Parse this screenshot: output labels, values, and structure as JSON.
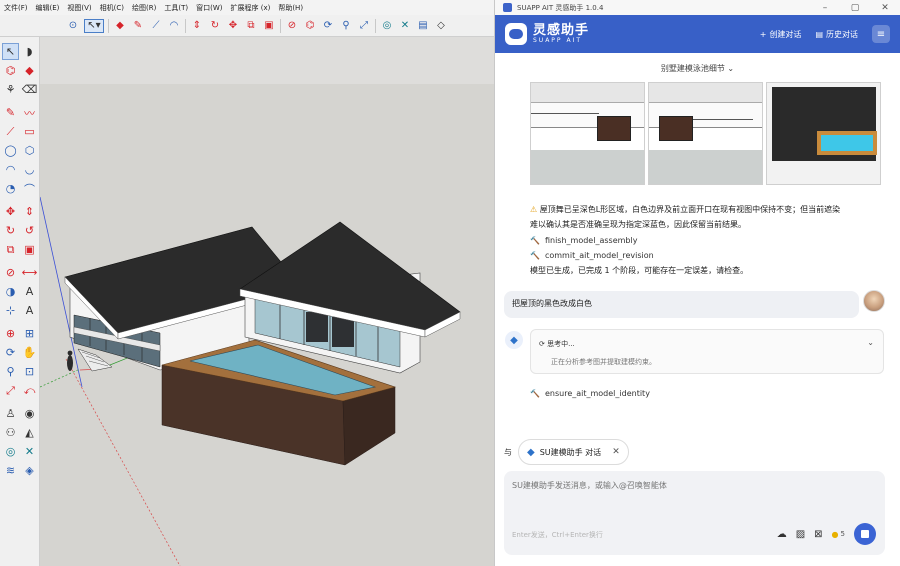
{
  "sketchup": {
    "menus": [
      "文件(F)",
      "编辑(E)",
      "视图(V)",
      "相机(C)",
      "绘图(R)",
      "工具(T)",
      "窗口(W)",
      "扩展程序 (x)",
      "帮助(H)"
    ]
  },
  "assistant": {
    "window_title": "SUAPP AIT 灵感助手 1.0.4",
    "brand_name": "灵感助手",
    "brand_sub": "SUAPP AIT",
    "new_chat": "创建对话",
    "history": "历史对话",
    "session_title": "别墅建模泳池细节",
    "messages": {
      "ai_note_line1": "屋顶舞已呈深色L形区域，白色边界及前立面开口在现有视图中保持不变；但当前遮染",
      "ai_note_line2": "难以确认其是否准确呈现为指定深蓝色，因此保留当前结果。",
      "tool1": "finish_model_assembly",
      "tool2": "commit_ait_model_revision",
      "result": "模型已生成，已完成 1 个阶段，可能存在一定误差，请检查。",
      "user": "把屋顶的黑色改成白色",
      "thinking_title": "思考中...",
      "thinking_desc": "正在分析参考图并提取建模约束。",
      "tool3": "ensure_ait_model_identity"
    },
    "chip_prefix": "与",
    "chip_label": "SU建模助手 对话",
    "composer_placeholder": "SU建模助手发送消息，或输入@召唤智能体",
    "composer_hint": "Enter发送，Ctrl+Enter换行",
    "credits": "5"
  },
  "colors": {
    "brand_blue": "#3860c7",
    "send_blue": "#3b64d4",
    "roof": "#2a2a2a",
    "pool": "#6fb2c4",
    "pool_deck": "#a3703d"
  }
}
